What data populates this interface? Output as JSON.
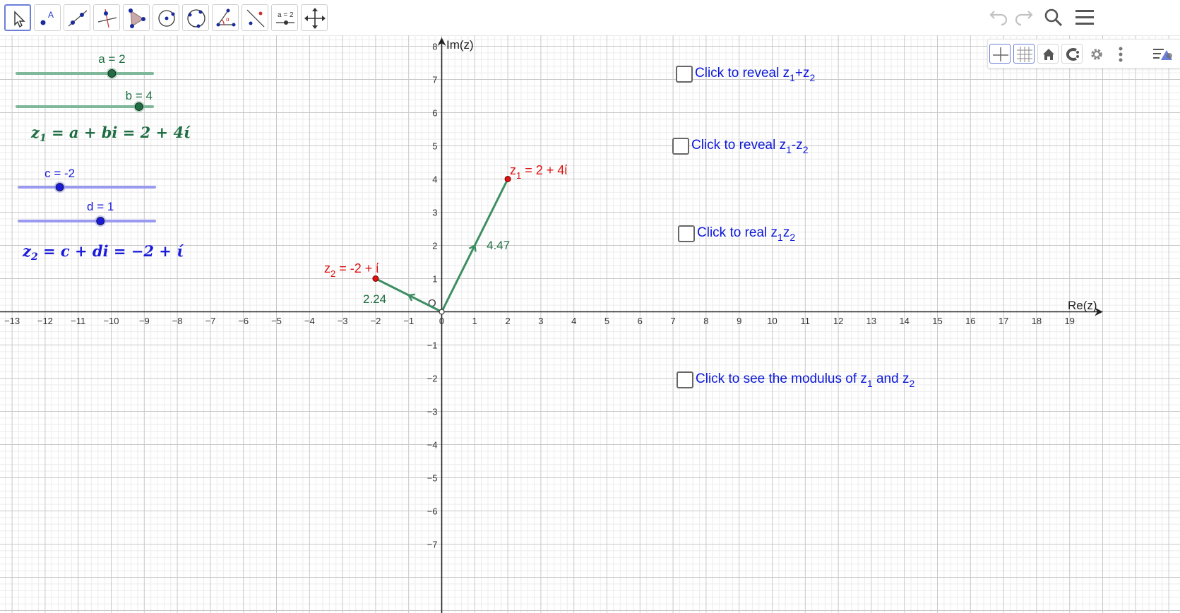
{
  "toolbar": {
    "tools": [
      {
        "name": "move-tool",
        "icon": "cursor-arrow-icon",
        "active": true
      },
      {
        "name": "point-tool",
        "icon": "point-icon",
        "label": "A"
      },
      {
        "name": "line-tool",
        "icon": "line-through-points-icon"
      },
      {
        "name": "perpendicular-line-tool",
        "icon": "perpendicular-line-icon"
      },
      {
        "name": "polygon-tool",
        "icon": "polygon-icon"
      },
      {
        "name": "circle-center-point-tool",
        "icon": "circle-center-point-icon"
      },
      {
        "name": "circle-three-points-tool",
        "icon": "circle-three-points-icon"
      },
      {
        "name": "angle-tool",
        "icon": "angle-icon",
        "label": "α"
      },
      {
        "name": "reflect-about-line-tool",
        "icon": "reflect-line-icon"
      },
      {
        "name": "slider-tool",
        "icon": "slider-icon",
        "label": "a = 2"
      },
      {
        "name": "move-graphics-view-tool",
        "icon": "move-cross-icon"
      }
    ],
    "right": [
      "undo-icon",
      "redo-icon",
      "search-icon",
      "menu-icon"
    ]
  },
  "style_bar": [
    "axes-toggle-icon",
    "grid-toggle-icon",
    "home-icon",
    "point-capturing-icon",
    "gear-icon",
    "more-vertical-icon",
    "style-bar-toggle-icon"
  ],
  "colors": {
    "green": "#1f6e43",
    "green_slider": "#7fb89a",
    "vector_green": "#3d8e63",
    "blue": "#1a1adb",
    "blue_slider": "#9a9af0",
    "red": "#dd1111",
    "grid_minor": "#ececec",
    "grid_major": "#c8c8c8",
    "checkbox_text": "#0b17d9"
  },
  "sliders": [
    {
      "name": "a",
      "label": "a = 2",
      "value": 2,
      "min": -5,
      "max": 5,
      "color": "green"
    },
    {
      "name": "b",
      "label": "b = 4",
      "value": 4,
      "min": -5,
      "max": 5,
      "color": "green"
    },
    {
      "name": "c",
      "label": "c = -2",
      "value": -2,
      "min": -5,
      "max": 5,
      "color": "blue"
    },
    {
      "name": "d",
      "label": "d = 1",
      "value": 1,
      "min": -5,
      "max": 5,
      "color": "blue"
    }
  ],
  "formulas": {
    "z1": {
      "lhs": "z",
      "sub": "1",
      "rhs": " = a + bi = 2 + 4ί"
    },
    "z2": {
      "lhs": "z",
      "sub": "2",
      "rhs": " = c + di = −2 + ί"
    }
  },
  "checkboxes": [
    {
      "text": "Click to reveal z",
      "s1": "1",
      "mid": "+z",
      "s2": "2",
      "end": "",
      "checked": false
    },
    {
      "text": "Click to reveal z",
      "s1": "1",
      "mid": "-z",
      "s2": "2",
      "end": "",
      "checked": false
    },
    {
      "text": "Click to real z",
      "s1": "1",
      "mid": "z",
      "s2": "2",
      "end": "",
      "checked": false
    },
    {
      "text": "Click to see the modulus of z",
      "s1": "1",
      "mid": " and z",
      "s2": "2",
      "end": "",
      "checked": false
    }
  ],
  "plane": {
    "x_axis_label": "Re(z)",
    "y_axis_label": "Im(z)",
    "origin_label": "O",
    "x_range": [
      -13,
      19
    ],
    "y_range": [
      -7,
      8
    ]
  },
  "points": [
    {
      "name": "z1",
      "re": 2,
      "im": 4,
      "label_main": "z",
      "label_sub": "1",
      "label_rest": " = 2 + 4ί"
    },
    {
      "name": "z2",
      "re": -2,
      "im": 1,
      "label_main": "z",
      "label_sub": "2",
      "label_rest": " = -2 + ί"
    }
  ],
  "vector_labels": [
    {
      "name": "z1",
      "text": "4.47"
    },
    {
      "name": "z2",
      "text": "2.24"
    }
  ]
}
